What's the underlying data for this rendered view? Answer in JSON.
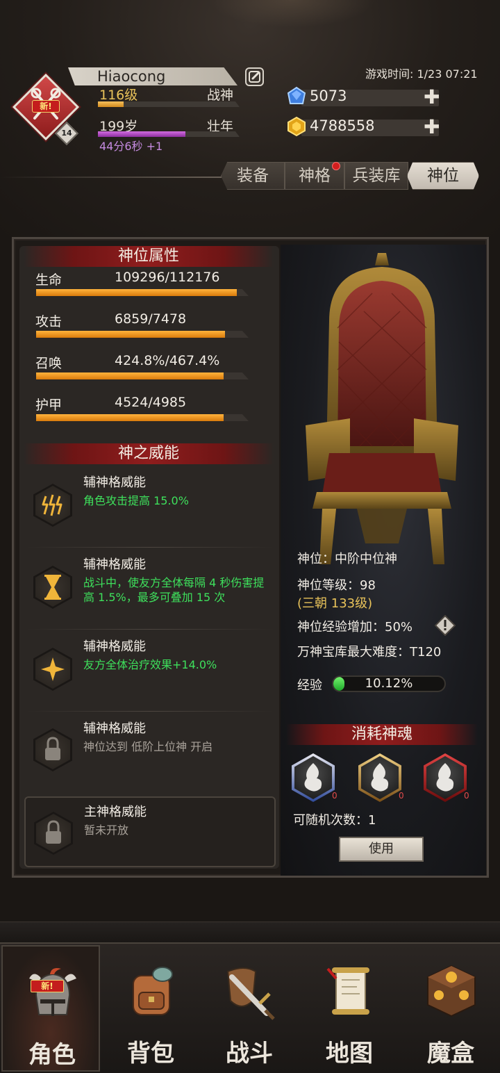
{
  "player": {
    "name": "Hiaocong",
    "level": "116级",
    "title": "战神",
    "age": "199岁",
    "age_stage": "壮年",
    "age_timer": "44分6秒 +1",
    "level_progress": 0.18,
    "age_progress": 0.62,
    "badge_level": "14",
    "emblem_tag": "新!"
  },
  "game_time": "游戏时间: 1/23 07:21",
  "currency": {
    "diamond": "5073",
    "gold": "4788558"
  },
  "tabs": [
    "装备",
    "神格",
    "兵装库",
    "神位"
  ],
  "attributes": {
    "header": "神位属性",
    "items": [
      {
        "label": "生命",
        "value": "109296/112176",
        "ratio": 0.974
      },
      {
        "label": "攻击",
        "value": "6859/7478",
        "ratio": 0.917
      },
      {
        "label": "召唤",
        "value": "424.8%/467.4%",
        "ratio": 0.909
      },
      {
        "label": "护甲",
        "value": "4524/4985",
        "ratio": 0.908
      }
    ]
  },
  "powers": {
    "header": "神之威能",
    "items": [
      {
        "title": "辅神格威能",
        "desc": "角色攻击提高 15.0%",
        "icon": "lightning-icon"
      },
      {
        "title": "辅神格威能",
        "desc": "战斗中，使友方全体每隔 4 秒伤害提高 1.5%，最多可叠加 15 次",
        "icon": "hourglass-icon"
      },
      {
        "title": "辅神格威能",
        "desc": "友方全体治疗效果+14.0%",
        "icon": "star-cross-icon"
      },
      {
        "title": "辅神格威能",
        "desc": "神位达到 低阶上位神 开启",
        "icon": "lock-icon"
      }
    ],
    "main": {
      "title": "主神格威能",
      "desc": "暂未开放",
      "icon": "lock-icon"
    }
  },
  "throne": {
    "rank": "神位：中阶中位神",
    "level": "神位等级：98",
    "level_note": "(三朝 133级)",
    "exp_bonus": "神位经验增加：50%",
    "vault_difficulty": "万神宝库最大难度：T120",
    "exp_label": "经验",
    "exp_percent": "10.12%",
    "exp_ratio": 0.1012
  },
  "souls": {
    "header": "消耗神魂",
    "counts": [
      "0",
      "0",
      "0"
    ],
    "random_times": "可随机次数：1",
    "use_label": "使用"
  },
  "nav": [
    "角色",
    "背包",
    "战斗",
    "地图",
    "魔盒"
  ],
  "nav_new_tag": "新!",
  "colors": {
    "accent_red": "#8f1d1d",
    "bar_orange": "#ffb33c",
    "power_green": "#3ee05c",
    "level_gold": "#e9c35a",
    "age_purple": "#c58be0"
  }
}
